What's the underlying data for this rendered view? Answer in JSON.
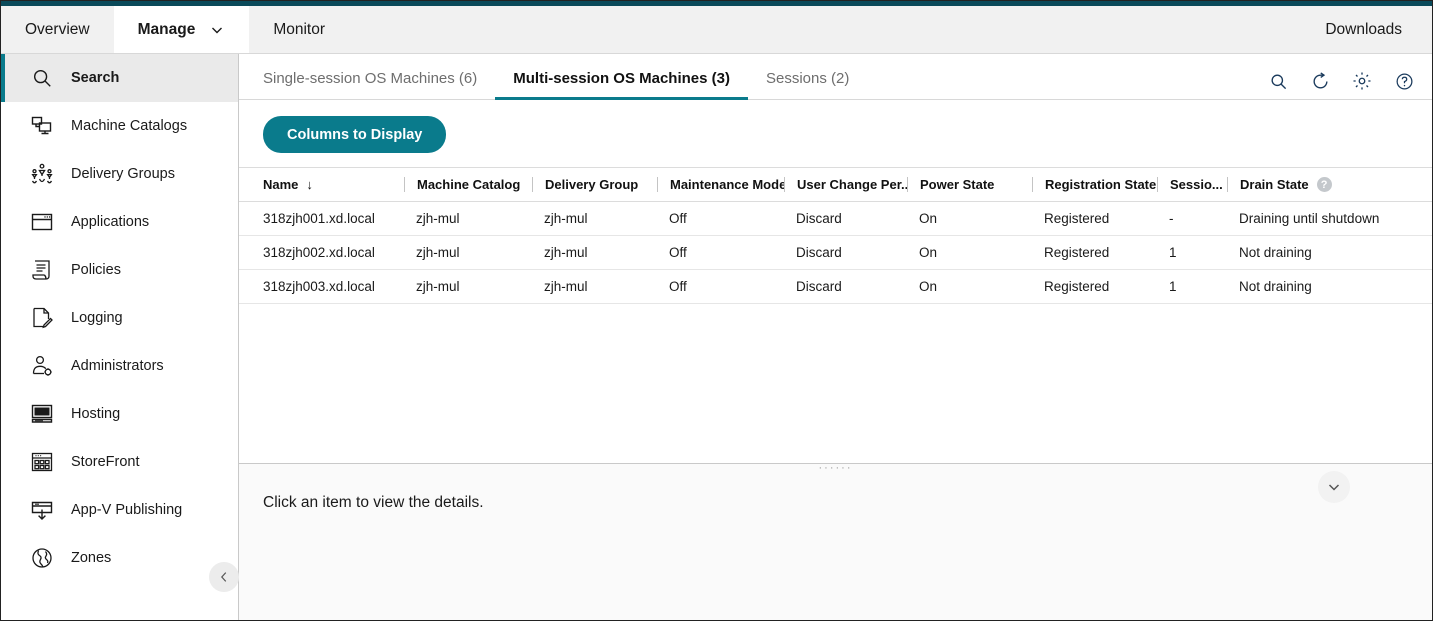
{
  "global_nav": {
    "items": [
      {
        "label": "Overview",
        "active": false,
        "caret": false
      },
      {
        "label": "Manage",
        "active": true,
        "caret": true
      },
      {
        "label": "Monitor",
        "active": false,
        "caret": false
      }
    ],
    "downloads_label": "Downloads"
  },
  "sidebar": {
    "items": [
      {
        "label": "Search",
        "icon": "search-icon",
        "active": true
      },
      {
        "label": "Machine Catalogs",
        "icon": "machine-catalogs-icon",
        "active": false
      },
      {
        "label": "Delivery Groups",
        "icon": "delivery-groups-icon",
        "active": false
      },
      {
        "label": "Applications",
        "icon": "applications-icon",
        "active": false
      },
      {
        "label": "Policies",
        "icon": "policies-icon",
        "active": false
      },
      {
        "label": "Logging",
        "icon": "logging-icon",
        "active": false
      },
      {
        "label": "Administrators",
        "icon": "administrators-icon",
        "active": false
      },
      {
        "label": "Hosting",
        "icon": "hosting-icon",
        "active": false
      },
      {
        "label": "StoreFront",
        "icon": "storefront-icon",
        "active": false
      },
      {
        "label": "App-V Publishing",
        "icon": "app-v-publishing-icon",
        "active": false
      },
      {
        "label": "Zones",
        "icon": "zones-icon",
        "active": false
      }
    ],
    "collapse_icon": "chevron-left-icon"
  },
  "tabs": [
    {
      "label": "Single-session OS Machines (6)",
      "active": false
    },
    {
      "label": "Multi-session OS Machines (3)",
      "active": true
    },
    {
      "label": "Sessions (2)",
      "active": false
    }
  ],
  "tab_actions": [
    {
      "icon": "search-icon"
    },
    {
      "icon": "refresh-icon"
    },
    {
      "icon": "gear-icon"
    },
    {
      "icon": "help-icon"
    }
  ],
  "toolbar": {
    "columns_button_label": "Columns to Display"
  },
  "table": {
    "columns": [
      {
        "label": "Name",
        "sorted": true,
        "sort_glyph": "↓",
        "help": false
      },
      {
        "label": "Machine Catalog",
        "sorted": false,
        "help": false
      },
      {
        "label": "Delivery Group",
        "sorted": false,
        "help": false
      },
      {
        "label": "Maintenance Mode",
        "sorted": false,
        "help": false
      },
      {
        "label": "User Change Per...",
        "sorted": false,
        "help": false
      },
      {
        "label": "Power State",
        "sorted": false,
        "help": false
      },
      {
        "label": "Registration State",
        "sorted": false,
        "help": false
      },
      {
        "label": "Sessio...",
        "sorted": false,
        "help": false
      },
      {
        "label": "Drain State",
        "sorted": false,
        "help": true,
        "help_glyph": "?"
      }
    ],
    "rows": [
      {
        "name": "318zjh001.xd.local",
        "machine_catalog": "zjh-mul",
        "delivery_group": "zjh-mul",
        "maintenance_mode": "Off",
        "user_change_persisted": "Discard",
        "power_state": "On",
        "registration_state": "Registered",
        "sessions": "-",
        "drain_state": "Draining until shutdown"
      },
      {
        "name": "318zjh002.xd.local",
        "machine_catalog": "zjh-mul",
        "delivery_group": "zjh-mul",
        "maintenance_mode": "Off",
        "user_change_persisted": "Discard",
        "power_state": "On",
        "registration_state": "Registered",
        "sessions": "1",
        "drain_state": "Not draining"
      },
      {
        "name": "318zjh003.xd.local",
        "machine_catalog": "zjh-mul",
        "delivery_group": "zjh-mul",
        "maintenance_mode": "Off",
        "user_change_persisted": "Discard",
        "power_state": "On",
        "registration_state": "Registered",
        "sessions": "1",
        "drain_state": "Not draining"
      }
    ]
  },
  "splitter": {
    "grip_glyph": "······",
    "collapse_icon": "chevron-down-icon"
  },
  "details": {
    "empty_text": "Click an item to view the details."
  },
  "colors": {
    "accent": "#0a7b8c",
    "top_strip": "#0a4a5a",
    "nav_bg": "#f1f1f1",
    "active_side_bg": "#eaeaea",
    "icon_blue": "#1a3a5c"
  }
}
